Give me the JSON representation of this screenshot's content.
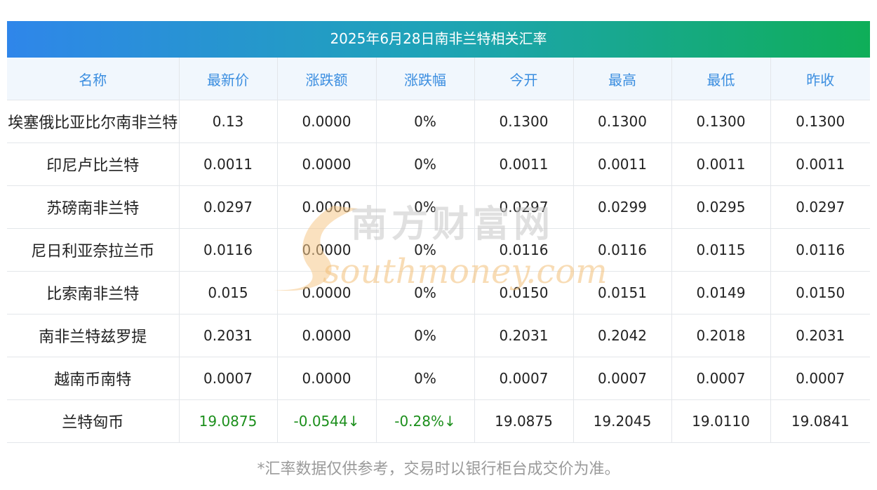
{
  "title": "2025年6月28日南非兰特相关汇率",
  "headers": [
    "名称",
    "最新价",
    "涨跌额",
    "涨跌幅",
    "今开",
    "最高",
    "最低",
    "昨收"
  ],
  "rows": [
    [
      "埃塞俄比亚比尔南非兰特",
      "0.13",
      "0.0000",
      "0%",
      "0.1300",
      "0.1300",
      "0.1300",
      "0.1300"
    ],
    [
      "印尼卢比兰特",
      "0.0011",
      "0.0000",
      "0%",
      "0.0011",
      "0.0011",
      "0.0011",
      "0.0011"
    ],
    [
      "苏磅南非兰特",
      "0.0297",
      "0.0000",
      "0%",
      "0.0297",
      "0.0299",
      "0.0295",
      "0.0297"
    ],
    [
      "尼日利亚奈拉兰币",
      "0.0116",
      "0.0000",
      "0%",
      "0.0116",
      "0.0116",
      "0.0115",
      "0.0116"
    ],
    [
      "比索南非兰特",
      "0.015",
      "0.0000",
      "0%",
      "0.0150",
      "0.0151",
      "0.0149",
      "0.0150"
    ],
    [
      "南非兰特兹罗提",
      "0.2031",
      "0.0000",
      "0%",
      "0.2031",
      "0.2042",
      "0.2018",
      "0.2031"
    ],
    [
      "越南币南特",
      "0.0007",
      "0.0000",
      "0%",
      "0.0007",
      "0.0007",
      "0.0007",
      "0.0007"
    ],
    [
      "兰特匈币",
      "19.0875",
      "-0.0544↓",
      "-0.28%↓",
      "19.0875",
      "19.2045",
      "19.0110",
      "19.0841"
    ]
  ],
  "watermark": {
    "cn": "南方财富网",
    "en": "southmoney.com"
  },
  "footnote": "*汇率数据仅供参考，交易时以银行柜台成交价为准。",
  "colors": {
    "header_text": "#3b8ee0",
    "down": "#1c8f1c",
    "gradient_start": "#2f86ea",
    "gradient_end": "#0fae58"
  }
}
